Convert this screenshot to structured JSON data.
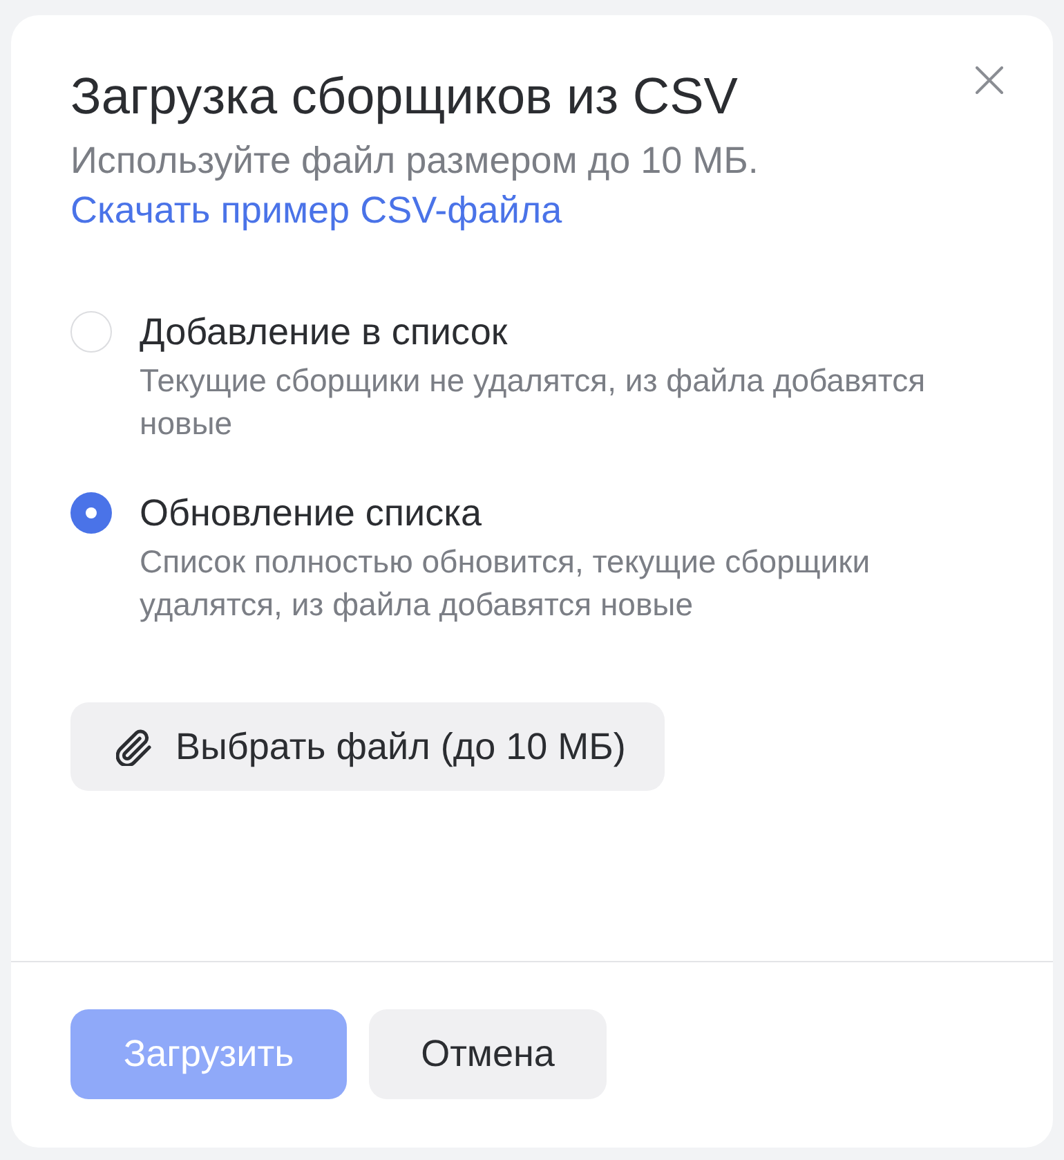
{
  "dialog": {
    "title": "Загрузка сборщиков из CSV",
    "subtitle": "Используйте файл размером до 10 МБ.",
    "link": "Скачать пример CSV-файла"
  },
  "modes": [
    {
      "label": "Добавление в список",
      "description": "Текущие сборщики не удалятся, из файла добавятся новые",
      "selected": false
    },
    {
      "label": "Обновление списка",
      "description": "Список полностью обновится, текущие сборщики удалятся, из файла добавятся новые",
      "selected": true
    }
  ],
  "file_button": {
    "label": "Выбрать файл (до 10 МБ)"
  },
  "buttons": [
    {
      "label": "Загрузить",
      "kind": "primary",
      "disabled": true
    },
    {
      "label": "Отмена",
      "kind": "secondary",
      "disabled": false
    }
  ]
}
